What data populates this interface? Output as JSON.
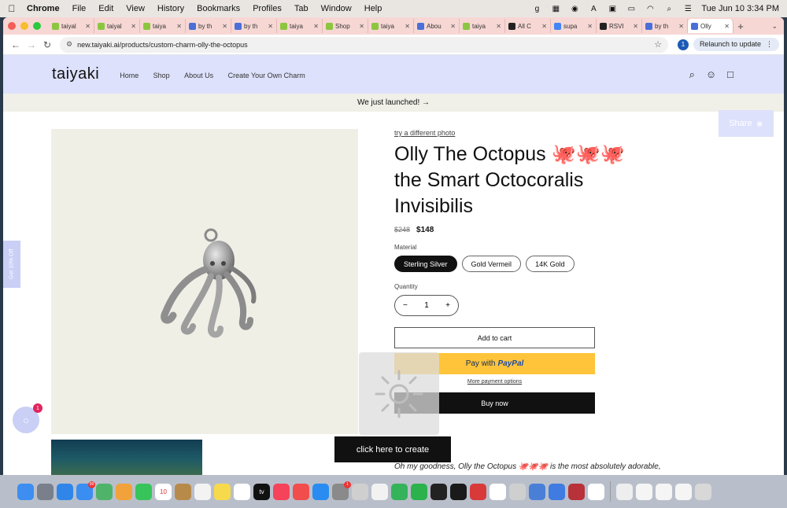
{
  "menubar": {
    "app": "Chrome",
    "items": [
      "File",
      "Edit",
      "View",
      "History",
      "Bookmarks",
      "Profiles",
      "Tab",
      "Window",
      "Help"
    ],
    "clock": "Tue Jun 10  3:34 PM"
  },
  "browser": {
    "tabs": [
      {
        "label": "taiyal",
        "fav": "#8cc63f"
      },
      {
        "label": "taiyal",
        "fav": "#8cc63f"
      },
      {
        "label": "taiya",
        "fav": "#8cc63f"
      },
      {
        "label": "by th",
        "fav": "#4a6fd8"
      },
      {
        "label": "by th",
        "fav": "#4a6fd8"
      },
      {
        "label": "taiya",
        "fav": "#8cc63f"
      },
      {
        "label": "Shop",
        "fav": "#8cc63f"
      },
      {
        "label": "taiya",
        "fav": "#8cc63f"
      },
      {
        "label": "Abou",
        "fav": "#4a6fd8"
      },
      {
        "label": "taiya",
        "fav": "#8cc63f"
      },
      {
        "label": "All C",
        "fav": "#222222"
      },
      {
        "label": "supa",
        "fav": "#4285f4"
      },
      {
        "label": "RSVI",
        "fav": "#222222"
      },
      {
        "label": "by th",
        "fav": "#4a6fd8"
      },
      {
        "label": "Olly",
        "fav": "#4a6fd8",
        "active": true
      }
    ],
    "url": "new.taiyaki.ai/products/custom-charm-olly-the-octopus",
    "profile_initial": "1",
    "relaunch_label": "Relaunch to update"
  },
  "site": {
    "logo": "taiyaki",
    "nav": [
      "Home",
      "Shop",
      "About Us",
      "Create Your Own Charm"
    ],
    "announcement": "We just launched! →"
  },
  "product": {
    "try_link": "try a different photo",
    "title": "Olly The Octopus 🐙🐙🐙 the Smart Octocoralis Invisibilis",
    "price_old": "$248",
    "price_new": "$148",
    "material_label": "Material",
    "materials": [
      "Sterling Silver",
      "Gold Vermeil",
      "14K Gold"
    ],
    "selected_material": 0,
    "quantity_label": "Quantity",
    "quantity": "1",
    "add_to_cart": "Add to cart",
    "paypal_prefix": "Pay with",
    "paypal_brand": "PayPal",
    "more_payment": "More payment options",
    "buy_now": "Buy now",
    "description": "Oh my goodness, Olly the Octopus 🐙🐙🐙 is the most absolutely adorable,"
  },
  "overlays": {
    "share_label": "Share",
    "side_tab": "Get 10% Off",
    "chat_badge": "1",
    "create_button": "click here to create"
  },
  "colors": {
    "header_bg": "#dde1fb",
    "tabbar_bg": "#f6d7d4",
    "paypal_yellow": "#ffc439"
  },
  "dock": [
    {
      "name": "finder-icon",
      "color": "#3d8ef0"
    },
    {
      "name": "launchpad-icon",
      "color": "#7a7f8c"
    },
    {
      "name": "safari-icon",
      "color": "#2f86e8"
    },
    {
      "name": "mail-icon",
      "color": "#3a8ef2",
      "badge": "99"
    },
    {
      "name": "maps-icon",
      "color": "#4fb36a"
    },
    {
      "name": "photos-icon",
      "color": "#f2a23a"
    },
    {
      "name": "facetime-icon",
      "color": "#37c45a"
    },
    {
      "name": "calendar-icon",
      "color": "#ffffff",
      "text": "10"
    },
    {
      "name": "notes-brown-icon",
      "color": "#b88a4a"
    },
    {
      "name": "reminders-icon",
      "color": "#f3f3f3"
    },
    {
      "name": "notes-icon",
      "color": "#f7d94c"
    },
    {
      "name": "freeform-icon",
      "color": "#ffffff"
    },
    {
      "name": "appletv-icon",
      "color": "#111111",
      "text": "tv"
    },
    {
      "name": "music-icon",
      "color": "#f5435a"
    },
    {
      "name": "news-icon",
      "color": "#f24d4d"
    },
    {
      "name": "appstore-icon",
      "color": "#2a8cf0"
    },
    {
      "name": "settings-icon",
      "color": "#8a8a8a",
      "badge": "1"
    },
    {
      "name": "pencil-icon",
      "color": "#cfcfcf"
    },
    {
      "name": "chrome-icon",
      "color": "#f2f2f2"
    },
    {
      "name": "chat-app-icon",
      "color": "#35b35a"
    },
    {
      "name": "whatsapp-icon",
      "color": "#2bb24c"
    },
    {
      "name": "terminal-icon",
      "color": "#222222"
    },
    {
      "name": "stocks-icon",
      "color": "#1a1a1a"
    },
    {
      "name": "red-app-icon",
      "color": "#d83a3a"
    },
    {
      "name": "f-app-icon",
      "color": "#ffffff"
    },
    {
      "name": "font-app-icon",
      "color": "#cfcfcf"
    },
    {
      "name": "preview-icon",
      "color": "#4a7fd8"
    },
    {
      "name": "keynote-icon",
      "color": "#3f7be0"
    },
    {
      "name": "dictionary-icon",
      "color": "#b8323a"
    },
    {
      "name": "g-app-icon",
      "color": "#ffffff"
    },
    {
      "name": "document-icon",
      "color": "#eeeeee"
    },
    {
      "name": "screenshot-1-icon",
      "color": "#f5f5f5"
    },
    {
      "name": "screenshot-2-icon",
      "color": "#f5f5f5"
    },
    {
      "name": "screenshot-3-icon",
      "color": "#f5f5f5"
    },
    {
      "name": "trash-icon",
      "color": "#d8d8d8"
    }
  ]
}
